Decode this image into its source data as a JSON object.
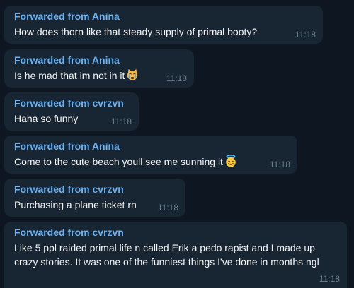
{
  "messages": [
    {
      "forwarded_from": "Forwarded from Anina",
      "text": "How does thorn like that steady supply of primal booty?",
      "time": "11:18"
    },
    {
      "forwarded_from": "Forwarded from Anina",
      "text": "Is he mad that im not in it",
      "emoji": "crying-cat-emoji",
      "time": "11:18"
    },
    {
      "forwarded_from": "Forwarded from cvrzvn",
      "text": "Haha so funny",
      "time": "11:18"
    },
    {
      "forwarded_from": "Forwarded from Anina",
      "text": "Come to the cute beach youll see me sunning it",
      "emoji": "smiling-face-with-halo-emoji",
      "time": "11:18"
    },
    {
      "forwarded_from": "Forwarded from cvrzvn",
      "text": "Purchasing a plane ticket rn",
      "time": "11:18"
    },
    {
      "forwarded_from": "Forwarded from cvrzvn",
      "text": "Like 5 ppl raided primal life n called Erik a pedo rapist and I made up crazy stories. It was one of the funniest things I've done in months ngl",
      "time": "11:18"
    }
  ],
  "colors": {
    "background": "#0e1621",
    "bubble": "#182533",
    "forwarded_name": "#6ab3f3",
    "text": "#f5f5f5",
    "time": "#6d7f8f"
  }
}
